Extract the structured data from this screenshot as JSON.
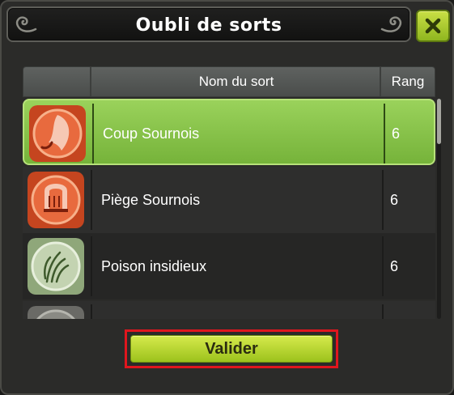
{
  "window": {
    "title": "Oubli de sorts"
  },
  "table": {
    "headers": {
      "name": "Nom du sort",
      "rank": "Rang"
    },
    "rows": [
      {
        "name": "Coup Sournois",
        "rank": "6",
        "icon": "coup-sournois-icon",
        "selected": true
      },
      {
        "name": "Piège Sournois",
        "rank": "6",
        "icon": "piege-sournois-icon",
        "selected": false
      },
      {
        "name": "Poison insidieux",
        "rank": "6",
        "icon": "poison-insidieux-icon",
        "selected": false
      }
    ]
  },
  "actions": {
    "validate_label": "Valider"
  },
  "colors": {
    "accent_green": "#9cc21c",
    "selected_row": "#86c34a",
    "highlight_border": "#e0161e"
  }
}
